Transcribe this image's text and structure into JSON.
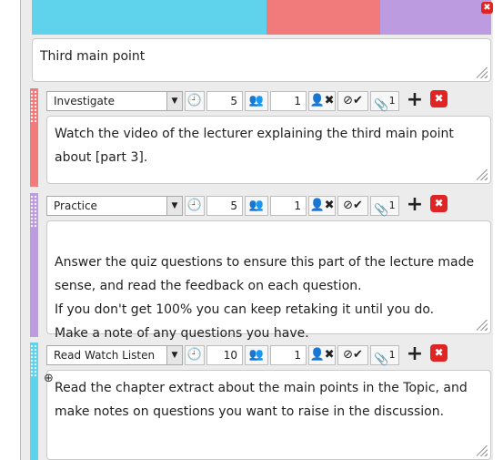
{
  "colors": {
    "cyan": "#5fd3ec",
    "salmon": "#f17b7b",
    "purple": "#bd9be0",
    "close_red": "#e02424"
  },
  "top_textbox": {
    "text": "Third main point"
  },
  "cards": [
    {
      "activity": "Investigate",
      "time": "5",
      "group": "1",
      "attachments_count": "1",
      "text": "Watch the video of the lecturer explaining the third main point about [part 3]."
    },
    {
      "activity": "Practice",
      "time": "5",
      "group": "1",
      "attachments_count": "1",
      "text": "Answer the quiz questions to ensure this part of the lecture made sense, and read the feedback on each question.\nIf you don't get 100% you can keep retaking it until you do.\nMake a note of any questions you have."
    },
    {
      "activity": "Read Watch Listen",
      "time": "10",
      "group": "1",
      "attachments_count": "1",
      "text": "Read the chapter extract about the main points in the Topic, and make notes on questions you want to raise in the discussion."
    }
  ],
  "icons": {
    "clock": "clock-icon",
    "group": "group-icon",
    "remove_user": "remove-user-icon",
    "assess": "assess-check-icon",
    "attach": "paperclip-icon",
    "add": "plus-icon",
    "close": "close-icon",
    "dropdown": "chevron-down-icon",
    "zoom": "zoom-icon"
  }
}
